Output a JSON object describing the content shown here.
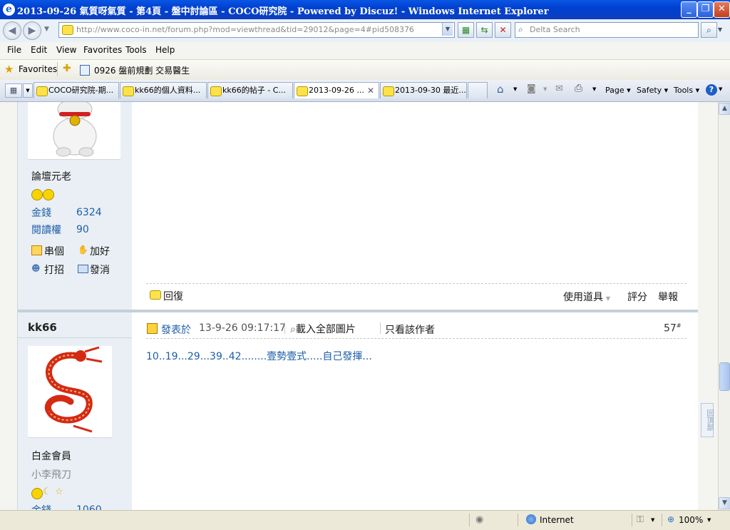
{
  "window": {
    "title": "2013-09-26 氣質呀氣質 - 第4頁 - 盤中討論區 - COCO研究院 - Powered by Discuz! - Windows Internet Explorer"
  },
  "address": {
    "url": "http://www.coco-in.net/forum.php?mod=viewthread&tid=29012&page=4#pid508376",
    "search_placeholder": "Delta Search"
  },
  "menu": [
    "File",
    "Edit",
    "View",
    "Favorites",
    "Tools",
    "Help"
  ],
  "favorites": {
    "label": "Favorites",
    "link": "0926 盤前規劃  交易醫生"
  },
  "tabs": [
    {
      "label": "COCO研究院-期...",
      "active": false
    },
    {
      "label": "kk66的個人資料...",
      "active": false
    },
    {
      "label": "kk66的帖子 - C...",
      "active": false
    },
    {
      "label": "2013-09-26 ...",
      "active": true
    },
    {
      "label": "2013-09-30 最近...",
      "active": false
    }
  ],
  "command_bar": {
    "page": "Page",
    "safety": "Safety",
    "tools": "Tools"
  },
  "post1": {
    "user_rank": "論壇元老",
    "money_label": "金錢",
    "money": "6324",
    "read_label": "閱讀權",
    "read": "90",
    "actions": {
      "visit": "串個",
      "add_friend": "加好",
      "greet": "打招",
      "message": "發消"
    },
    "reply": "回復",
    "tools": "使用道具",
    "rate": "評分",
    "report": "舉報"
  },
  "post2": {
    "username": "kk66",
    "posted_label": "發表於",
    "posted_time": "13-9-26 09:17:17",
    "load_images": "載入全部圖片",
    "author_only": "只看該作者",
    "floor": "57",
    "floor_suffix": "#",
    "body": "10..19...29...39..42........壹勢壹式.....自己發揮...",
    "user_rank": "白金會員",
    "custom_title": "小李飛刀",
    "money_label": "金錢",
    "money": "1060"
  },
  "back_to_top": "回頂部",
  "status": {
    "zone": "Internet",
    "zoom": "100%"
  }
}
